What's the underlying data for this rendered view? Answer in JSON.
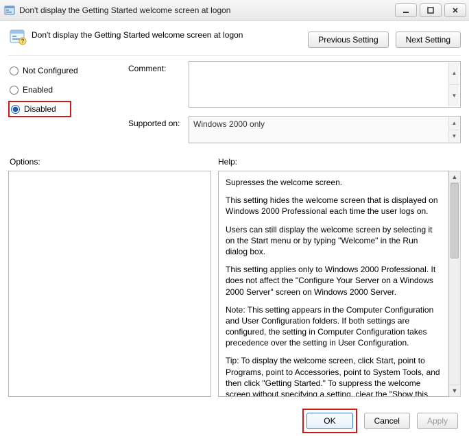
{
  "window": {
    "title": "Don't display the Getting Started welcome screen at logon"
  },
  "header": {
    "policy_title": "Don't display the Getting Started welcome screen at logon",
    "prev": "Previous Setting",
    "next": "Next Setting"
  },
  "radios": {
    "not_configured": "Not Configured",
    "enabled": "Enabled",
    "disabled": "Disabled",
    "selected": "disabled"
  },
  "labels": {
    "comment": "Comment:",
    "supported": "Supported on:",
    "options": "Options:",
    "help": "Help:"
  },
  "supported_text": "Windows 2000 only",
  "help": {
    "p1": "Supresses the welcome screen.",
    "p2": "This setting hides the welcome screen that is displayed on Windows 2000 Professional each time the user logs on.",
    "p3": "Users can still display the welcome screen by selecting it on the Start menu or by typing \"Welcome\" in the Run dialog box.",
    "p4": "This setting applies only to Windows 2000 Professional. It does not affect the \"Configure Your Server on a Windows 2000 Server\" screen on Windows 2000 Server.",
    "p5": "Note: This setting appears in the Computer Configuration and User Configuration folders. If both settings are configured, the setting in Computer Configuration takes precedence over the setting in User Configuration.",
    "p6": "Tip: To display the welcome screen, click Start, point to Programs, point to Accessories, point to System Tools, and then click \"Getting Started.\" To suppress the welcome screen without specifying a setting, clear the \"Show this screen at startup\" check"
  },
  "footer": {
    "ok": "OK",
    "cancel": "Cancel",
    "apply": "Apply"
  }
}
